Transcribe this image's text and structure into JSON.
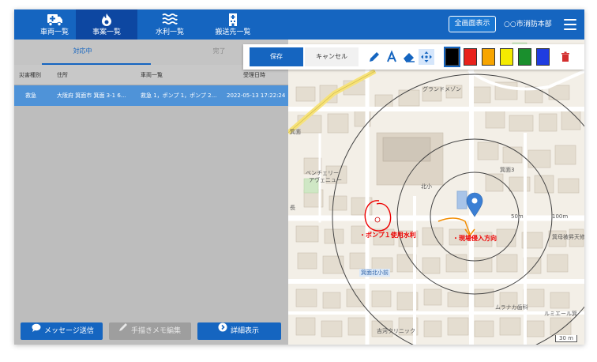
{
  "nav": {
    "tabs": [
      {
        "label": "車両一覧",
        "icon": "ambulance-icon"
      },
      {
        "label": "事案一覧",
        "icon": "flame-icon",
        "active": true
      },
      {
        "label": "水利一覧",
        "icon": "water-icon"
      },
      {
        "label": "搬送先一覧",
        "icon": "hospital-icon"
      }
    ],
    "fullscreen_label": "全画面表示",
    "headquarters": "○○市消防本部"
  },
  "incident_panel": {
    "subtabs": [
      "対応中",
      "完了"
    ],
    "active_subtab": 0,
    "columns": [
      "災害種別",
      "住所",
      "車両一覧",
      "受理日時"
    ],
    "rows": [
      {
        "type": "救急",
        "address": "大阪府 箕面市 箕面 3-1 6…",
        "vehicles": "救急 1，ポンプ 1，ポンプ 2…",
        "received": "2022-05-13 17:22:24"
      }
    ],
    "buttons": {
      "message": "メッセージ送信",
      "memo": "手描きメモ編集",
      "detail": "詳細表示"
    }
  },
  "drawing_toolbar": {
    "save_label": "保存",
    "cancel_label": "キャンセル",
    "colors": [
      "#000000",
      "#e8221c",
      "#f7a500",
      "#f4ea00",
      "#1a8f2d",
      "#1f3ce0"
    ],
    "selected_color": 0
  },
  "map": {
    "labels": {
      "grand_mansion": "グランドメゾン",
      "school": "箕面3",
      "north_elem": "北小",
      "venchery": "ベンチェリー",
      "venchery2": "アヴェニュー",
      "pump_water": "・ポンプ１使用水利",
      "entry_dir": "・現場侵入方向",
      "station": "箕面北小前",
      "muragaka": "ムラナカ歯科",
      "luminere": "ルミエール箕",
      "clinic": "吉河クリニック",
      "kasumi": "箕母被昇天修",
      "road_sign": "箕面",
      "ring50": "50m",
      "ring100": "100m",
      "scale": "30 m",
      "cho": "長"
    }
  }
}
